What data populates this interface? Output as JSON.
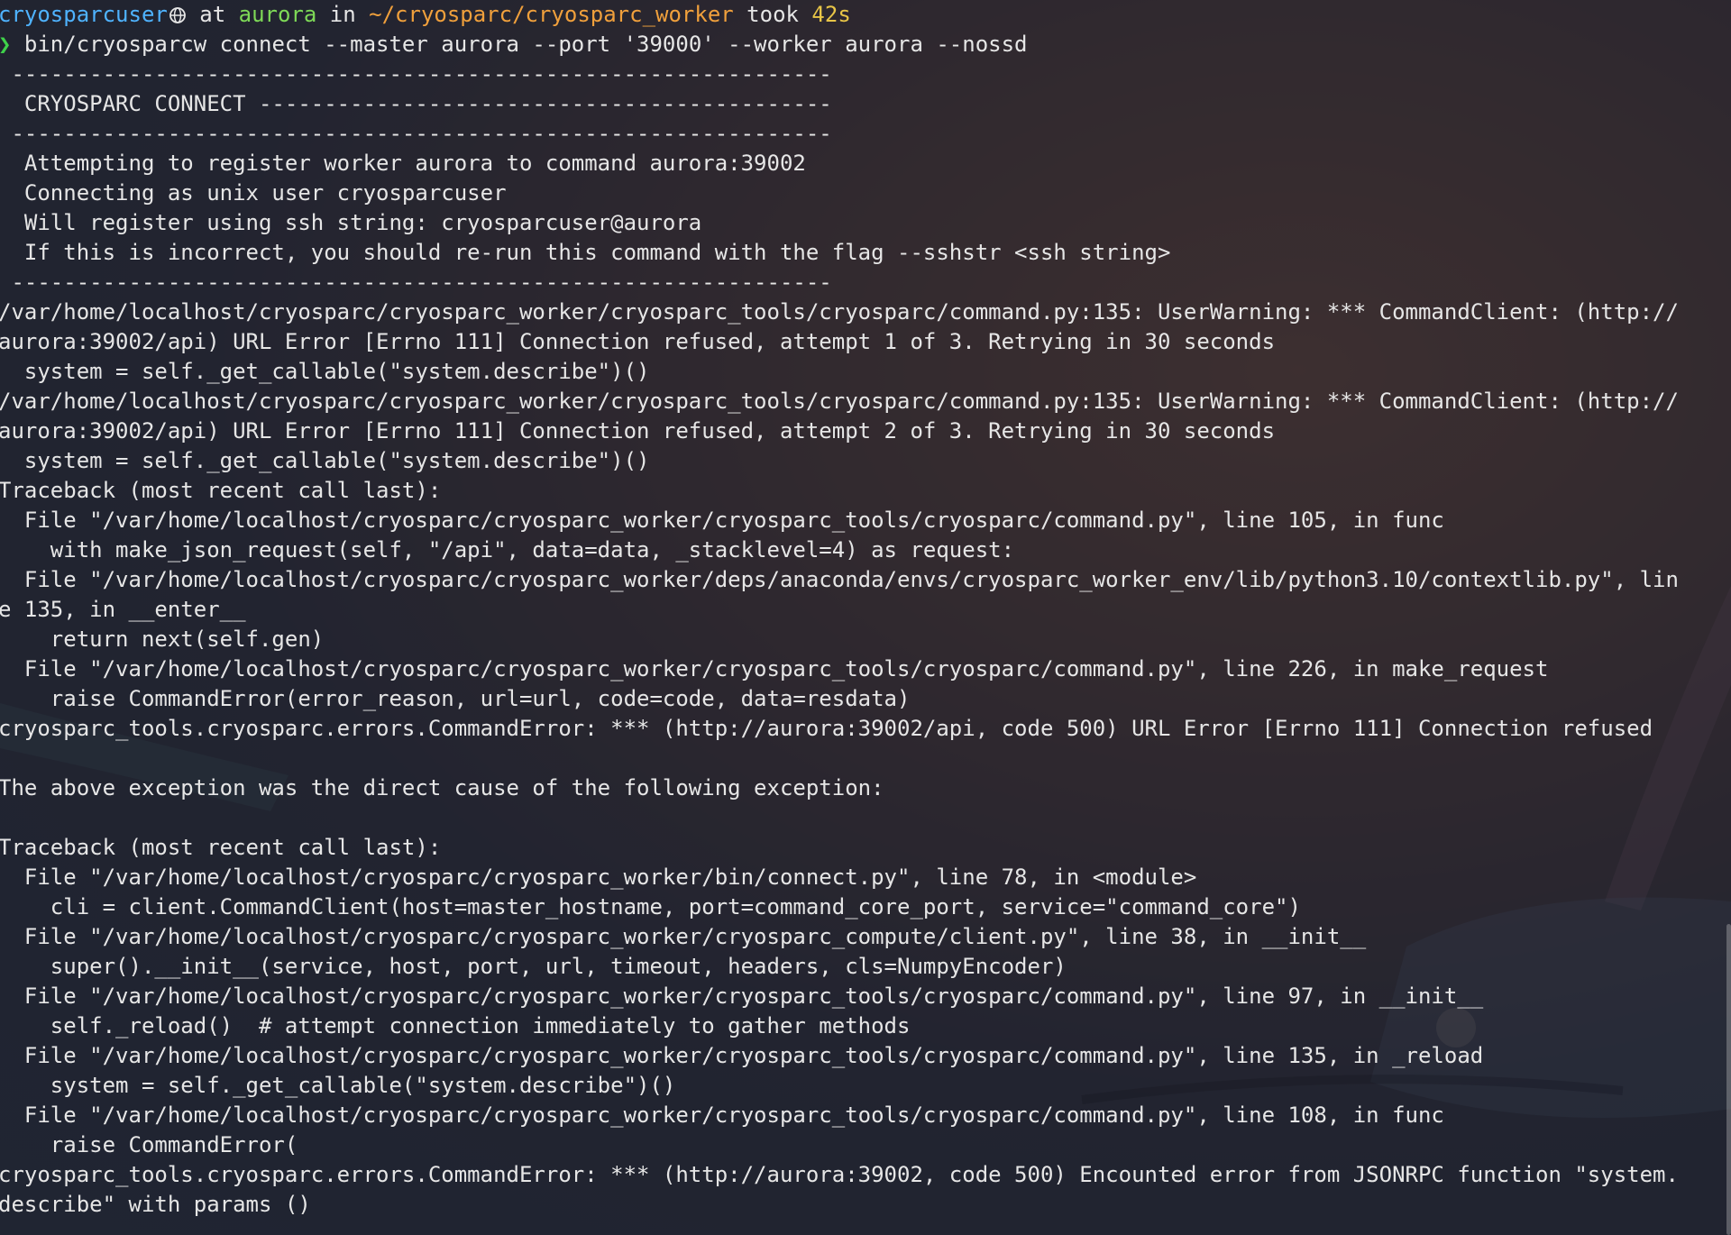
{
  "prompt": {
    "user": "cryosparcuser",
    "user_icon": "globe-icon",
    "at": " at ",
    "host": "aurora",
    "in": " in ",
    "path": "~/cryosparc/cryosparc_worker",
    "took": " took ",
    "duration": "42s",
    "arrow": "❯",
    "command": " bin/cryosparcw connect --master aurora --port '39000' --worker aurora --nossd"
  },
  "output": [
    " ---------------------------------------------------------------",
    "  CRYOSPARC CONNECT --------------------------------------------",
    " ---------------------------------------------------------------",
    "  Attempting to register worker aurora to command aurora:39002",
    "  Connecting as unix user cryosparcuser",
    "  Will register using ssh string: cryosparcuser@aurora",
    "  If this is incorrect, you should re-run this command with the flag --sshstr <ssh string>",
    " ---------------------------------------------------------------",
    "/var/home/localhost/cryosparc/cryosparc_worker/cryosparc_tools/cryosparc/command.py:135: UserWarning: *** CommandClient: (http://",
    "aurora:39002/api) URL Error [Errno 111] Connection refused, attempt 1 of 3. Retrying in 30 seconds",
    "  system = self._get_callable(\"system.describe\")()",
    "/var/home/localhost/cryosparc/cryosparc_worker/cryosparc_tools/cryosparc/command.py:135: UserWarning: *** CommandClient: (http://",
    "aurora:39002/api) URL Error [Errno 111] Connection refused, attempt 2 of 3. Retrying in 30 seconds",
    "  system = self._get_callable(\"system.describe\")()",
    "Traceback (most recent call last):",
    "  File \"/var/home/localhost/cryosparc/cryosparc_worker/cryosparc_tools/cryosparc/command.py\", line 105, in func",
    "    with make_json_request(self, \"/api\", data=data, _stacklevel=4) as request:",
    "  File \"/var/home/localhost/cryosparc/cryosparc_worker/deps/anaconda/envs/cryosparc_worker_env/lib/python3.10/contextlib.py\", lin",
    "e 135, in __enter__",
    "    return next(self.gen)",
    "  File \"/var/home/localhost/cryosparc/cryosparc_worker/cryosparc_tools/cryosparc/command.py\", line 226, in make_request",
    "    raise CommandError(error_reason, url=url, code=code, data=resdata)",
    "cryosparc_tools.cryosparc.errors.CommandError: *** (http://aurora:39002/api, code 500) URL Error [Errno 111] Connection refused",
    "",
    "The above exception was the direct cause of the following exception:",
    "",
    "Traceback (most recent call last):",
    "  File \"/var/home/localhost/cryosparc/cryosparc_worker/bin/connect.py\", line 78, in <module>",
    "    cli = client.CommandClient(host=master_hostname, port=command_core_port, service=\"command_core\")",
    "  File \"/var/home/localhost/cryosparc/cryosparc_worker/cryosparc_compute/client.py\", line 38, in __init__",
    "    super().__init__(service, host, port, url, timeout, headers, cls=NumpyEncoder)",
    "  File \"/var/home/localhost/cryosparc/cryosparc_worker/cryosparc_tools/cryosparc/command.py\", line 97, in __init__",
    "    self._reload()  # attempt connection immediately to gather methods",
    "  File \"/var/home/localhost/cryosparc/cryosparc_worker/cryosparc_tools/cryosparc/command.py\", line 135, in _reload",
    "    system = self._get_callable(\"system.describe\")()",
    "  File \"/var/home/localhost/cryosparc/cryosparc_worker/cryosparc_tools/cryosparc/command.py\", line 108, in func",
    "    raise CommandError(",
    "cryosparc_tools.cryosparc.errors.CommandError: *** (http://aurora:39002, code 500) Encounted error from JSONRPC function \"system.",
    "describe\" with params ()"
  ],
  "colors": {
    "user": "#4fb3ff",
    "host": "#7ed957",
    "path": "#f0a03c",
    "duration": "#e8c547",
    "arrow": "#3fd14a",
    "text": "#e6e6e6"
  }
}
